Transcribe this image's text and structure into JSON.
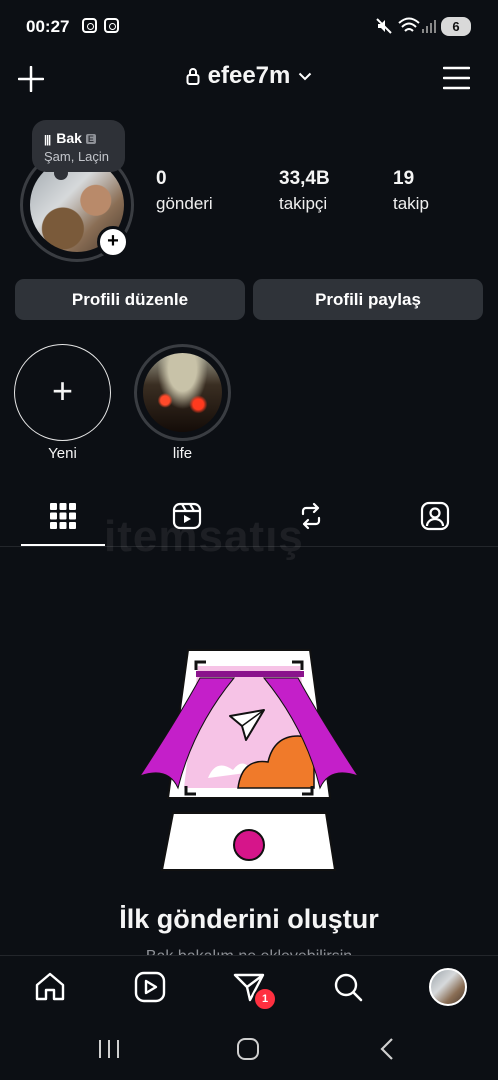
{
  "status_bar": {
    "time": "00:27",
    "battery": "6"
  },
  "header": {
    "username": "efee7m"
  },
  "profile": {
    "note_title": "Bak",
    "note_badge": "E",
    "note_subtitle": "Şam, Laçin",
    "stats": [
      {
        "value": "0",
        "label": "gönderi"
      },
      {
        "value": "33,4B",
        "label": "takipçi"
      },
      {
        "value": "19",
        "label": "takip"
      }
    ]
  },
  "buttons": {
    "edit": "Profili düzenle",
    "share": "Profili paylaş"
  },
  "highlights": [
    {
      "label": "Yeni"
    },
    {
      "label": "life"
    }
  ],
  "watermark": "itemsatış",
  "empty_state": {
    "title": "İlk gönderini oluştur",
    "subtitle": "Bak bakalım ne ekleyebilirsin"
  },
  "bottom_nav": {
    "messages_badge": "1"
  },
  "colors": {
    "background": "#0c0f14",
    "button": "#2f3339",
    "badge": "#ff3040",
    "illustration_magenta": "#c41fc9",
    "illustration_orange": "#f07a2a"
  }
}
